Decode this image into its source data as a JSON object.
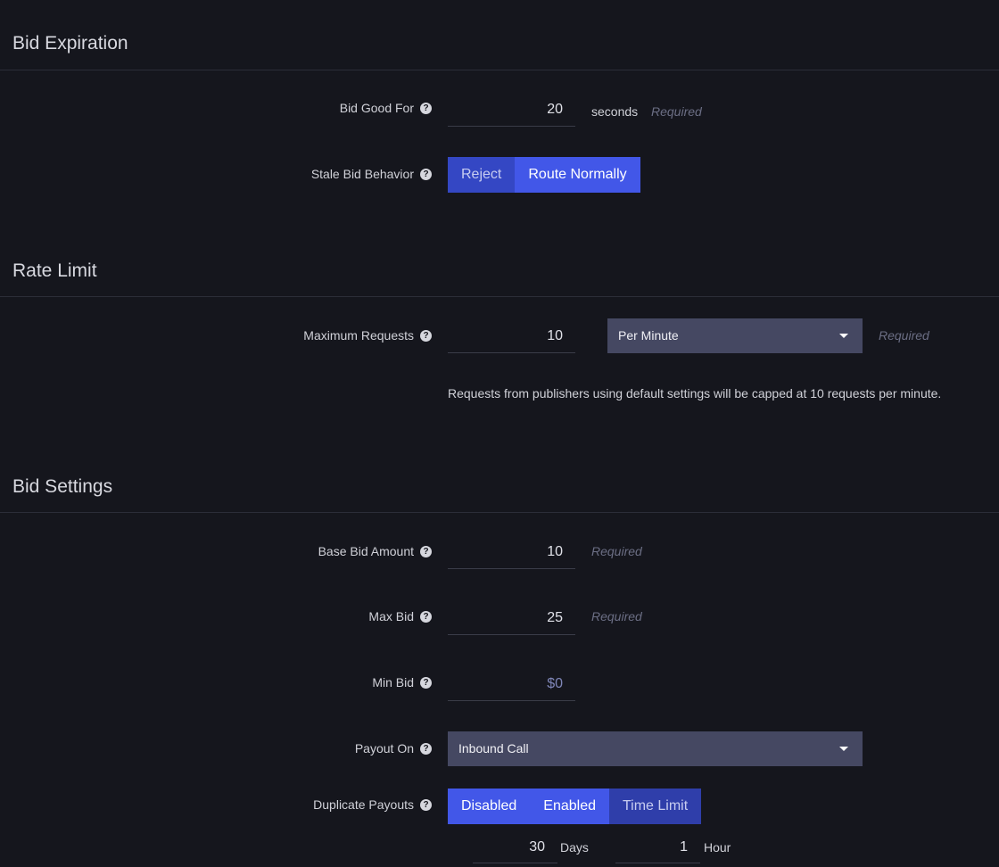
{
  "bid_expiration": {
    "title": "Bid Expiration",
    "bid_good_for": {
      "label": "Bid Good For",
      "value": "20",
      "unit": "seconds",
      "required": "Required"
    },
    "stale_bid_behavior": {
      "label": "Stale Bid Behavior",
      "options": [
        "Reject",
        "Route Normally"
      ],
      "selected": "Route Normally"
    }
  },
  "rate_limit": {
    "title": "Rate Limit",
    "maximum_requests": {
      "label": "Maximum Requests",
      "value": "10",
      "period": "Per Minute",
      "required": "Required"
    },
    "note": "Requests from publishers using default settings will be capped at 10 requests per minute."
  },
  "bid_settings": {
    "title": "Bid Settings",
    "base_bid_amount": {
      "label": "Base Bid Amount",
      "value": "10",
      "required": "Required"
    },
    "max_bid": {
      "label": "Max Bid",
      "value": "25",
      "required": "Required"
    },
    "min_bid": {
      "label": "Min Bid",
      "placeholder": "$0"
    },
    "payout_on": {
      "label": "Payout On",
      "value": "Inbound Call"
    },
    "duplicate_payouts": {
      "label": "Duplicate Payouts",
      "options": [
        "Disabled",
        "Enabled",
        "Time Limit"
      ],
      "selected": "Time Limit",
      "days_value": "30",
      "days_unit": "Days",
      "hours_value": "1",
      "hours_unit": "Hour"
    }
  },
  "icons": {
    "help": "question-circle-icon",
    "dropdown": "caret-down-icon"
  },
  "colors": {
    "background": "#15161d",
    "accent": "#4257e8",
    "select_bg": "#454862",
    "required_text": "#6b6e84"
  }
}
